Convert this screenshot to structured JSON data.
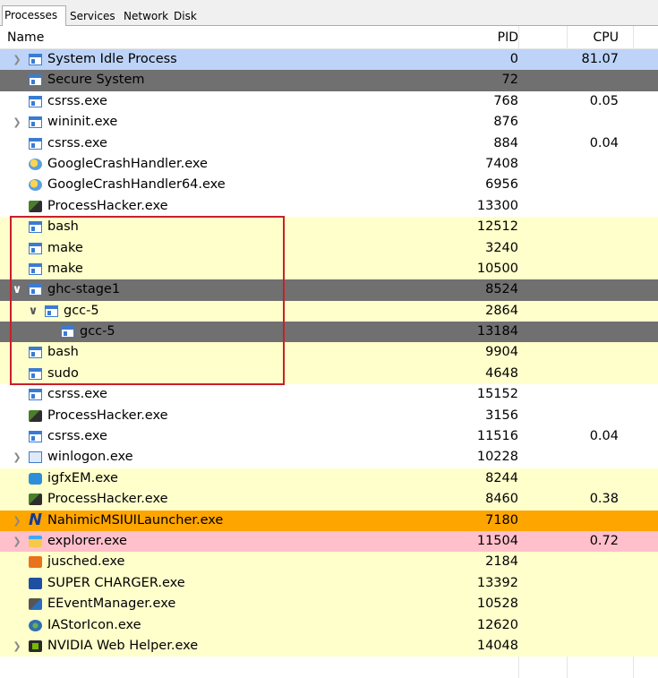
{
  "tabs": [
    {
      "label": "Processes",
      "active": true
    },
    {
      "label": "Services",
      "active": false
    },
    {
      "label": "Network",
      "active": false
    },
    {
      "label": "Disk",
      "active": false
    }
  ],
  "columns": {
    "name": "Name",
    "pid": "PID",
    "cpu": "CPU"
  },
  "colors": {
    "selected": "#bdd3f7",
    "dark": "#707070",
    "yellow": "#ffffcc",
    "orange": "#ffa500",
    "pink": "#ffc0cb",
    "white": "#ffffff",
    "highlight_box": "#c8202a"
  },
  "processes": [
    {
      "name": "System Idle Process",
      "pid": "0",
      "cpu": "81.07",
      "indent": 0,
      "expander": "collapsed",
      "icon": "window-icon",
      "bg": "selected"
    },
    {
      "name": "Secure System",
      "pid": "72",
      "cpu": "",
      "indent": 0,
      "expander": "none",
      "icon": "window-icon",
      "bg": "dark"
    },
    {
      "name": "csrss.exe",
      "pid": "768",
      "cpu": "0.05",
      "indent": 0,
      "expander": "none",
      "icon": "window-icon",
      "bg": "white"
    },
    {
      "name": "wininit.exe",
      "pid": "876",
      "cpu": "",
      "indent": 0,
      "expander": "collapsed",
      "icon": "window-icon",
      "bg": "white"
    },
    {
      "name": "csrss.exe",
      "pid": "884",
      "cpu": "0.04",
      "indent": 0,
      "expander": "none",
      "icon": "window-icon",
      "bg": "white"
    },
    {
      "name": "GoogleCrashHandler.exe",
      "pid": "7408",
      "cpu": "",
      "indent": 0,
      "expander": "none",
      "icon": "google-crash-handler-icon",
      "bg": "white"
    },
    {
      "name": "GoogleCrashHandler64.exe",
      "pid": "6956",
      "cpu": "",
      "indent": 0,
      "expander": "none",
      "icon": "google-crash-handler-icon",
      "bg": "white"
    },
    {
      "name": "ProcessHacker.exe",
      "pid": "13300",
      "cpu": "",
      "indent": 0,
      "expander": "none",
      "icon": "process-hacker-icon",
      "bg": "white"
    },
    {
      "name": "bash",
      "pid": "12512",
      "cpu": "",
      "indent": 0,
      "expander": "none",
      "icon": "window-icon",
      "bg": "yellow"
    },
    {
      "name": "make",
      "pid": "3240",
      "cpu": "",
      "indent": 0,
      "expander": "none",
      "icon": "window-icon",
      "bg": "yellow"
    },
    {
      "name": "make",
      "pid": "10500",
      "cpu": "",
      "indent": 0,
      "expander": "none",
      "icon": "window-icon",
      "bg": "yellow"
    },
    {
      "name": "ghc-stage1",
      "pid": "8524",
      "cpu": "",
      "indent": 0,
      "expander": "expanded",
      "icon": "window-icon",
      "bg": "dark"
    },
    {
      "name": "gcc-5",
      "pid": "2864",
      "cpu": "",
      "indent": 1,
      "expander": "expanded",
      "icon": "window-icon",
      "bg": "yellow"
    },
    {
      "name": "gcc-5",
      "pid": "13184",
      "cpu": "",
      "indent": 2,
      "expander": "none",
      "icon": "window-icon",
      "bg": "dark"
    },
    {
      "name": "bash",
      "pid": "9904",
      "cpu": "",
      "indent": 0,
      "expander": "none",
      "icon": "window-icon",
      "bg": "yellow"
    },
    {
      "name": "sudo",
      "pid": "4648",
      "cpu": "",
      "indent": 0,
      "expander": "none",
      "icon": "window-icon",
      "bg": "yellow"
    },
    {
      "name": "csrss.exe",
      "pid": "15152",
      "cpu": "",
      "indent": 0,
      "expander": "none",
      "icon": "window-icon",
      "bg": "white"
    },
    {
      "name": "ProcessHacker.exe",
      "pid": "3156",
      "cpu": "",
      "indent": 0,
      "expander": "none",
      "icon": "process-hacker-icon",
      "bg": "white"
    },
    {
      "name": "csrss.exe",
      "pid": "11516",
      "cpu": "0.04",
      "indent": 0,
      "expander": "none",
      "icon": "window-icon",
      "bg": "white"
    },
    {
      "name": "winlogon.exe",
      "pid": "10228",
      "cpu": "",
      "indent": 0,
      "expander": "collapsed",
      "icon": "winlogon-icon",
      "bg": "white"
    },
    {
      "name": "igfxEM.exe",
      "pid": "8244",
      "cpu": "",
      "indent": 0,
      "expander": "none",
      "icon": "intel-graphics-icon",
      "bg": "yellow"
    },
    {
      "name": "ProcessHacker.exe",
      "pid": "8460",
      "cpu": "0.38",
      "indent": 0,
      "expander": "none",
      "icon": "process-hacker-icon",
      "bg": "yellow"
    },
    {
      "name": "NahimicMSIUILauncher.exe",
      "pid": "7180",
      "cpu": "",
      "indent": 0,
      "expander": "collapsed",
      "icon": "nahimic-icon",
      "bg": "orange"
    },
    {
      "name": "explorer.exe",
      "pid": "11504",
      "cpu": "0.72",
      "indent": 0,
      "expander": "collapsed",
      "icon": "explorer-folder-icon",
      "bg": "pink"
    },
    {
      "name": "jusched.exe",
      "pid": "2184",
      "cpu": "",
      "indent": 0,
      "expander": "none",
      "icon": "java-icon",
      "bg": "yellow"
    },
    {
      "name": "SUPER CHARGER.exe",
      "pid": "13392",
      "cpu": "",
      "indent": 0,
      "expander": "none",
      "icon": "super-charger-icon",
      "bg": "yellow"
    },
    {
      "name": "EEventManager.exe",
      "pid": "10528",
      "cpu": "",
      "indent": 0,
      "expander": "none",
      "icon": "event-manager-icon",
      "bg": "yellow"
    },
    {
      "name": "IAStorIcon.exe",
      "pid": "12620",
      "cpu": "",
      "indent": 0,
      "expander": "none",
      "icon": "intel-storage-icon",
      "bg": "yellow"
    },
    {
      "name": "NVIDIA Web Helper.exe",
      "pid": "14048",
      "cpu": "",
      "indent": 0,
      "expander": "collapsed",
      "icon": "nvidia-icon",
      "bg": "yellow"
    }
  ]
}
